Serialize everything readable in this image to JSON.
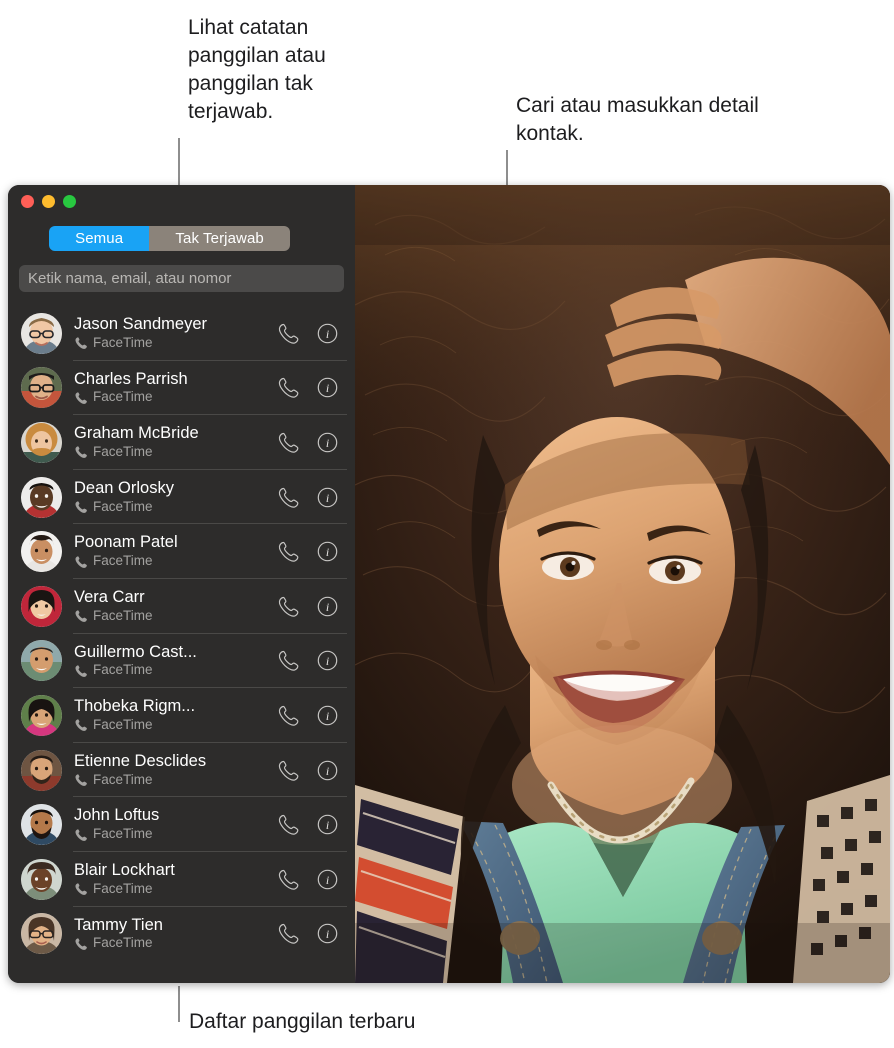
{
  "annotations": {
    "left": "Lihat catatan panggilan atau panggilan tak terjawab.",
    "right": "Cari atau masukkan detail kontak.",
    "bottom": "Daftar panggilan terbaru"
  },
  "window": {
    "traffic_lights": [
      {
        "name": "close",
        "color": "#FF5F57"
      },
      {
        "name": "minimize",
        "color": "#FEBC2E"
      },
      {
        "name": "zoom",
        "color": "#28C840"
      }
    ]
  },
  "sidebar": {
    "segmented_control": {
      "selected": "Semua",
      "options": [
        {
          "label": "Semua",
          "active": true,
          "color": "#19A3F5"
        },
        {
          "label": "Tak Terjawab",
          "active": false,
          "color": "#8B837A"
        }
      ]
    },
    "search": {
      "placeholder": "Ketik nama, email, atau nomor",
      "value": ""
    },
    "contacts": [
      {
        "name": "Jason Sandmeyer",
        "service": "FaceTime"
      },
      {
        "name": "Charles Parrish",
        "service": "FaceTime"
      },
      {
        "name": "Graham McBride",
        "service": "FaceTime"
      },
      {
        "name": "Dean Orlosky",
        "service": "FaceTime"
      },
      {
        "name": "Poonam Patel",
        "service": "FaceTime"
      },
      {
        "name": "Vera Carr",
        "service": "FaceTime"
      },
      {
        "name": "Guillermo Cast...",
        "service": "FaceTime"
      },
      {
        "name": "Thobeka Rigm...",
        "service": "FaceTime"
      },
      {
        "name": "Etienne Desclides",
        "service": "FaceTime"
      },
      {
        "name": "John Loftus",
        "service": "FaceTime"
      },
      {
        "name": "Blair Lockhart",
        "service": "FaceTime"
      },
      {
        "name": "Tammy Tien",
        "service": "FaceTime"
      }
    ],
    "row_actions": {
      "call_label": "Audio call",
      "info_label": "Info"
    }
  },
  "photo": {
    "description": "Portrait of a smiling woman with curly dark hair raising her hand to her head, wearing a mint green top, denim overalls and a patterned shawl with a beaded necklace."
  }
}
